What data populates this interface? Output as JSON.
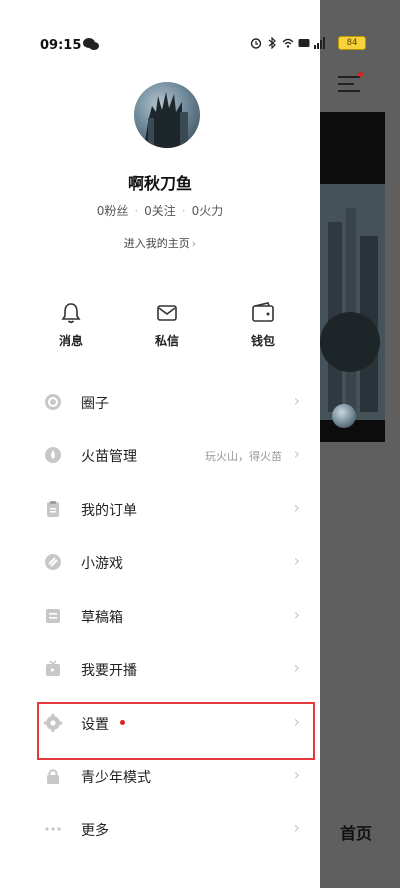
{
  "status_bar": {
    "time": "09:15",
    "battery": "84"
  },
  "profile": {
    "name": "啊秋刀鱼",
    "stats": {
      "followers": "0粉丝",
      "following": "0关注",
      "fire": "0火力"
    },
    "homepage_link": "进入我的主页"
  },
  "quick_actions": [
    {
      "label": "消息",
      "icon": "bell-icon"
    },
    {
      "label": "私信",
      "icon": "envelope-icon"
    },
    {
      "label": "钱包",
      "icon": "wallet-icon"
    }
  ],
  "menu": [
    {
      "label": "圈子",
      "icon": "circle-icon"
    },
    {
      "label": "火苗管理",
      "icon": "flame-icon",
      "hint": "玩火山，得火苗"
    },
    {
      "label": "我的订单",
      "icon": "clipboard-icon"
    },
    {
      "label": "小游戏",
      "icon": "game-icon"
    },
    {
      "label": "草稿箱",
      "icon": "drafts-icon"
    },
    {
      "label": "我要开播",
      "icon": "live-camera-icon"
    },
    {
      "label": "设置",
      "icon": "gear-icon",
      "new_badge": true
    },
    {
      "label": "青少年模式",
      "icon": "lock-icon"
    },
    {
      "label": "更多",
      "icon": "more-dots-icon"
    }
  ],
  "background": {
    "tab_home": "首页"
  },
  "colors": {
    "highlight": "#e5383b",
    "badge": "#e02020"
  }
}
